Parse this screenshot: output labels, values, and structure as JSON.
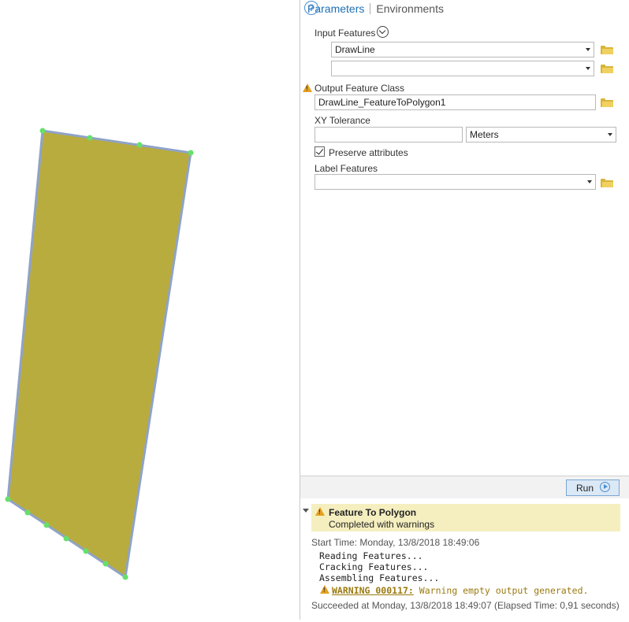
{
  "tabs": {
    "parameters": "Parameters",
    "environments": "Environments"
  },
  "help_icon": "help-icon",
  "input_features": {
    "label": "Input Features",
    "rows": [
      {
        "value": "DrawLine"
      },
      {
        "value": ""
      }
    ]
  },
  "output_feature_class": {
    "label": "Output Feature Class",
    "value": "DrawLine_FeatureToPolygon1"
  },
  "xy_tolerance": {
    "label": "XY Tolerance",
    "value": "",
    "unit": "Meters"
  },
  "preserve_attributes": {
    "label": "Preserve attributes",
    "checked": true
  },
  "label_features": {
    "label": "Label Features",
    "value": ""
  },
  "run_button": {
    "label": "Run"
  },
  "messages": {
    "tool_name": "Feature To Polygon",
    "status": "Completed with warnings",
    "start_time": "Start Time: Monday, 13/8/2018 18:49:06",
    "lines": [
      "Reading Features...",
      "Cracking Features...",
      "Assembling Features..."
    ],
    "warning_code": "WARNING 000117:",
    "warning_text": "Warning empty output generated.",
    "succeeded": "Succeeded at Monday, 13/8/2018 18:49:07 (Elapsed Time: 0,91 seconds)"
  },
  "colors": {
    "polygon_fill": "#b9ac3e",
    "polygon_outline": "#8fa3c7",
    "vertex": "#66e06a",
    "accent": "#1f6fb4",
    "warning_bg": "#f5efc0"
  }
}
